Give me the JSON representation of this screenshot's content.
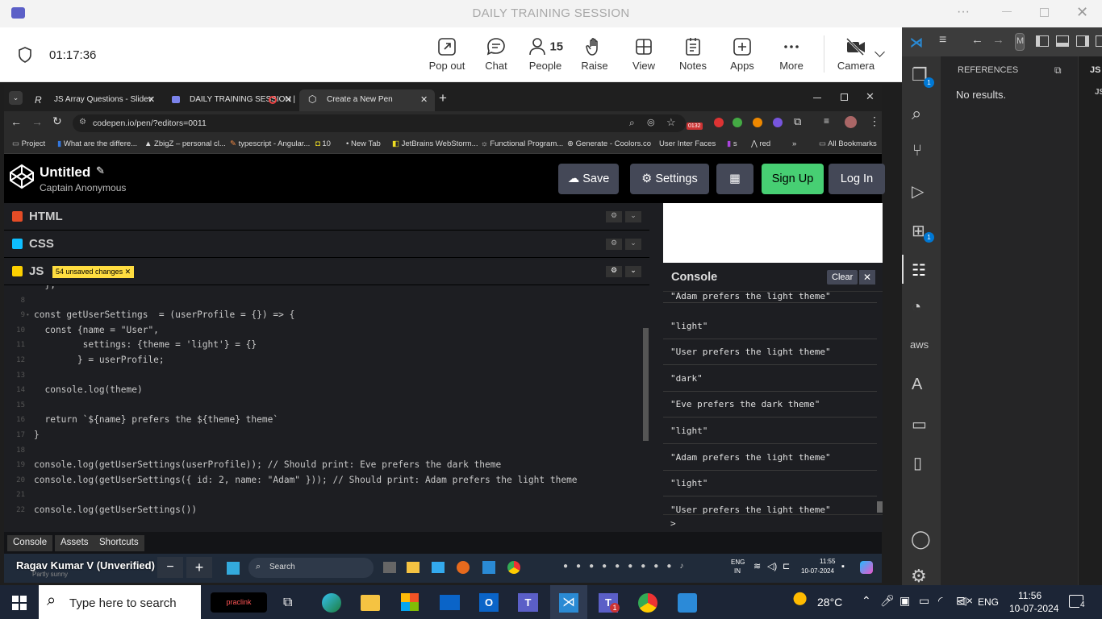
{
  "window": {
    "title": "DAILY TRAINING SESSION"
  },
  "meeting": {
    "timer": "01:17:36",
    "toolbar": [
      {
        "label": "Pop out",
        "icon": "pop-out-icon"
      },
      {
        "label": "Chat",
        "icon": "chat-icon"
      },
      {
        "label": "People",
        "icon": "people-icon",
        "count": "15"
      },
      {
        "label": "Raise",
        "icon": "raise-hand-icon"
      },
      {
        "label": "View",
        "icon": "view-icon"
      },
      {
        "label": "Notes",
        "icon": "notes-icon"
      },
      {
        "label": "Apps",
        "icon": "apps-icon"
      },
      {
        "label": "More",
        "icon": "more-icon"
      },
      {
        "label": "Camera",
        "icon": "camera-off-icon"
      }
    ],
    "presenter": "Ragav Kumar V (Unverified)"
  },
  "browser": {
    "tabs": [
      {
        "label": "JS Array Questions - Slidev",
        "active": false
      },
      {
        "label": "DAILY TRAINING SESSION |",
        "active": false
      },
      {
        "label": "Create a New Pen",
        "active": true
      }
    ],
    "url": "codepen.io/pen/?editors=0011",
    "ext_badge": "0132",
    "bookmarks": [
      "Project",
      "What are the differe...",
      "ZbigZ – personal cl...",
      "typescript - Angular...",
      "10",
      "New Tab",
      "JetBrains WebStorm...",
      "Functional Program...",
      "Generate - Coolors.co",
      "User Inter Faces",
      "s",
      "red",
      "All Bookmarks"
    ]
  },
  "codepen": {
    "title": "Untitled",
    "author": "Captain Anonymous",
    "buttons": {
      "save": "Save",
      "settings": "Settings",
      "signup": "Sign Up",
      "login": "Log In"
    },
    "panels": {
      "html": "HTML",
      "css": "CSS",
      "js": "JS"
    },
    "unsaved": "54 unsaved changes",
    "code_lines": [
      {
        "n": "",
        "text": "  };"
      },
      {
        "n": "8",
        "text": ""
      },
      {
        "n": "9",
        "text": "const getUserSettings  = (userProfile = {}) => {"
      },
      {
        "n": "10",
        "text": "  const {name = \"User\","
      },
      {
        "n": "11",
        "text": "         settings: {theme = 'light'} = {}"
      },
      {
        "n": "12",
        "text": "        } = userProfile;"
      },
      {
        "n": "13",
        "text": ""
      },
      {
        "n": "14",
        "text": "  console.log(theme)"
      },
      {
        "n": "15",
        "text": ""
      },
      {
        "n": "16",
        "text": "  return `${name} prefers the ${theme} theme`"
      },
      {
        "n": "17",
        "text": "}"
      },
      {
        "n": "18",
        "text": ""
      },
      {
        "n": "19",
        "text": "console.log(getUserSettings(userProfile)); // Should print: Eve prefers the dark theme"
      },
      {
        "n": "20",
        "text": "console.log(getUserSettings({ id: 2, name: \"Adam\" })); // Should print: Adam prefers the light theme"
      },
      {
        "n": "21",
        "text": ""
      },
      {
        "n": "22",
        "text": "console.log(getUserSettings())"
      }
    ],
    "console": {
      "title": "Console",
      "clear": "Clear",
      "lines": [
        "\"Adam prefers the light theme\"",
        "\"light\"",
        "\"User prefers the light theme\"",
        "\"dark\"",
        "\"Eve prefers the dark theme\"",
        "\"light\"",
        "\"Adam prefers the light theme\"",
        "\"light\"",
        "\"User prefers the light theme\""
      ],
      "prompt": ">"
    },
    "footer_tabs": [
      "Console",
      "Assets",
      "Shortcuts"
    ]
  },
  "inner_taskbar": {
    "search": "Search",
    "lang": "ENG",
    "region": "IN",
    "time": "11:55",
    "date": "10-07-2024",
    "weather": "Partly sunny"
  },
  "vscode": {
    "panel_title": "REFERENCES",
    "empty": "No results.",
    "badges": [
      "1",
      "1"
    ],
    "cmd_fragment": "M",
    "tab_fragment": "JS",
    "side_fragment": "JS"
  },
  "taskbar": {
    "search_placeholder": "Type here to search",
    "temperature": "28°C",
    "lang": "ENG",
    "time": "11:56",
    "date": "10-07-2024",
    "notifications": "4",
    "teams_badge": "1",
    "widget_label": "praclink"
  }
}
